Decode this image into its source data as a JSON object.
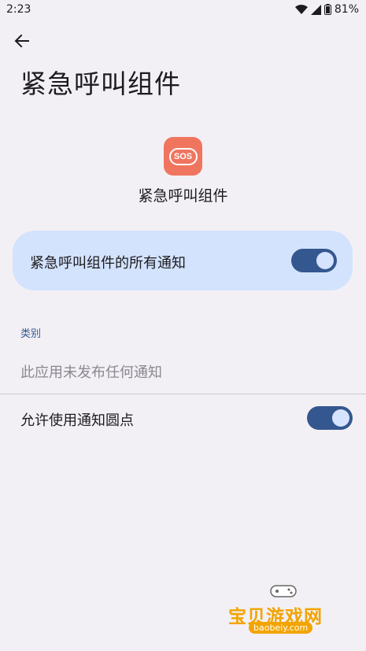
{
  "status_bar": {
    "time": "2:23",
    "battery": "81%",
    "icons": [
      "wifi-icon",
      "signal-icon",
      "battery-icon"
    ]
  },
  "header": {
    "back_icon": "arrow-back-icon",
    "title": "紧急呼叫组件"
  },
  "app": {
    "icon_text": "SOS",
    "name": "紧急呼叫组件",
    "icon_color": "#f0755f"
  },
  "all_notifications": {
    "label": "紧急呼叫组件的所有通知",
    "enabled": true
  },
  "categories": {
    "header": "类别",
    "empty_text": "此应用未发布任何通知"
  },
  "notification_dots": {
    "label": "允许使用通知圆点",
    "enabled": true
  },
  "watermark": {
    "name": "宝贝游戏网",
    "url": "baobeiy.com"
  },
  "colors": {
    "background": "#f3f0f5",
    "card": "#d3e3fd",
    "switch_track": "#35578f",
    "accent": "#35578f",
    "watermark": "#f2a400"
  }
}
